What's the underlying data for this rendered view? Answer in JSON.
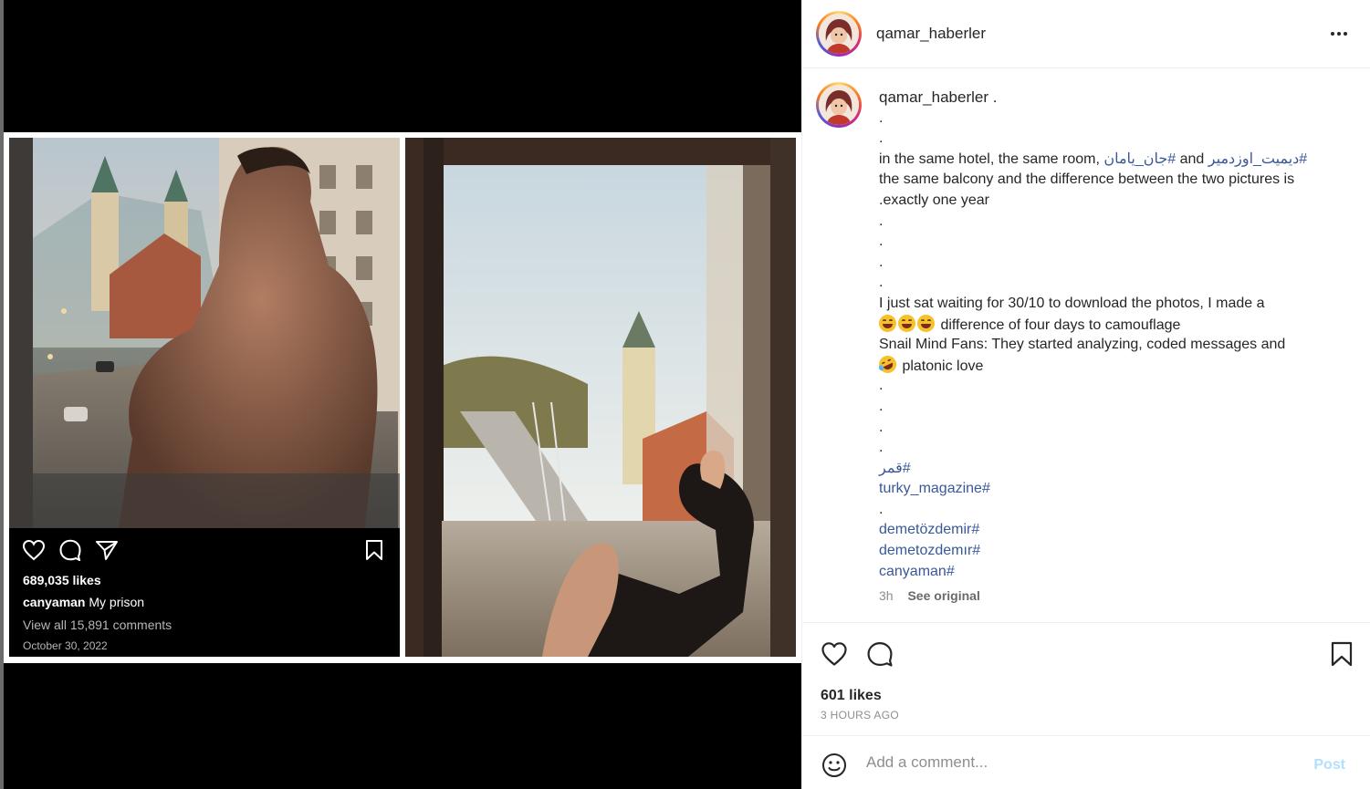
{
  "post": {
    "username": "qamar_haberler",
    "caption_user": "qamar_haberler .",
    "caption": {
      "l1": ".",
      "l2": ".",
      "l3_a": "in the same hotel, the same room, ",
      "l3_tag1": "جان_يامان#",
      "l3_b": " and ",
      "l3_tag2": "ديميت_اوزدمير#",
      "l4": "the same balcony and the difference between the two pictures is",
      "l5": ".exactly one year",
      "l6": ".",
      "l7": ".",
      "l8": ".",
      "l9": ".",
      "l10": "I just sat waiting for 30/10 to download the photos, I made a",
      "l11": " difference of four days to camouflage",
      "l12": "Snail Mind Fans: They started analyzing, coded messages and",
      "l13": " platonic love",
      "l14": ".",
      "l15": ".",
      "l16": ".",
      "l17": ".",
      "tag_qamar": "قمر#",
      "tag_turky": "turky_magazine#",
      "l20": ".",
      "tag_demet1": "demetözdemir#",
      "tag_demet2": "demetozdemır#",
      "tag_canyaman": "canyaman#"
    },
    "time_short": "3h",
    "see_original": "See original",
    "likes": "601 likes",
    "time_ago": "3 HOURS AGO",
    "comment_placeholder": "Add a comment...",
    "post_label": "Post"
  },
  "embedded_screenshot": {
    "likes": "689,035 likes",
    "caption_user": "canyaman",
    "caption_text": " My prison",
    "comments": "View all 15,891 comments",
    "date": "October 30, 2022"
  },
  "icons": {
    "more": "more-options-icon",
    "like": "heart-icon",
    "comment": "comment-icon",
    "save": "bookmark-icon",
    "emoji": "smiley-icon"
  },
  "colors": {
    "hashtag": "#385898",
    "post_button": "#b2dffc"
  }
}
